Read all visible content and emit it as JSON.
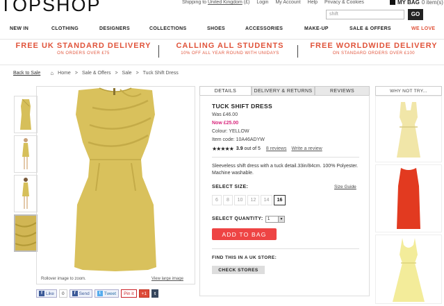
{
  "brand": "TOPSHOP",
  "toplinks": {
    "shipping_prefix": "Shipping to",
    "country": "United Kingdom",
    "currency": "(£)",
    "login": "Login",
    "account": "My Account",
    "help": "Help",
    "privacy": "Privacy & Cookies"
  },
  "bag": {
    "label": "MY BAG",
    "count": "0 item(s)"
  },
  "search": {
    "placeholder": "shift",
    "go": "GO"
  },
  "nav": [
    "NEW IN",
    "CLOTHING",
    "DESIGNERS",
    "COLLECTIONS",
    "SHOES",
    "ACCESSORIES",
    "MAKE-UP",
    "SALE & OFFERS",
    "WE LOVE"
  ],
  "promos": [
    {
      "title": "FREE UK STANDARD DELIVERY",
      "sub": "ON ORDERS OVER £75"
    },
    {
      "title": "CALLING ALL STUDENTS",
      "sub": "10% OFF ALL YEAR ROUND WITH UNIDAYS"
    },
    {
      "title": "FREE WORLDWIDE DELIVERY",
      "sub": "ON STANDARD ORDERS OVER £100"
    }
  ],
  "breadcrumb": {
    "back": "Back to Sale",
    "home": "Home",
    "c1": "Sale & Offers",
    "c2": "Sale",
    "c3": "Tuck Shift Dress"
  },
  "image": {
    "zoom_hint": "Rollover image to zoom.",
    "view_large": "View large image"
  },
  "social": {
    "like": "Like",
    "like_count": "0",
    "send": "Send",
    "tweet": "Tweet",
    "pin": "Pin it",
    "plus": "+1",
    "tumblr": "t"
  },
  "tabs": [
    "DETAILS",
    "DELIVERY & RETURNS",
    "REVIEWS"
  ],
  "product": {
    "title": "TUCK SHIFT DRESS",
    "was": "Was £46.00",
    "now": "Now £25.00",
    "colour": "Colour: YELLOW",
    "code": "Item code: 10A46ADYW",
    "stars": "★★★★★",
    "rating_strong": "3.9",
    "rating_rest": "out of 5",
    "rating_value": 3.9,
    "reviews": "8 reviews",
    "write_review": "Write a review",
    "description": "Sleeveless shift dress with a tuck detail.33in/84cm. 100% Polyester. Machine washable.",
    "select_size": "SELECT SIZE:",
    "size_guide": "Size Guide",
    "sizes": [
      "6",
      "8",
      "10",
      "12",
      "14",
      "16"
    ],
    "selected_size": "16",
    "select_qty": "SELECT QUANTITY:",
    "qty": "1",
    "add_to_bag": "ADD TO BAG",
    "find_store": "FIND THIS IN A UK STORE:",
    "check_stores": "CHECK STORES"
  },
  "why_not": "WHY NOT TRY...",
  "colors": {
    "accent": "#ee4444",
    "promo": "#e0533a",
    "sale": "#d8267c",
    "dress": "#d6bf5a"
  }
}
